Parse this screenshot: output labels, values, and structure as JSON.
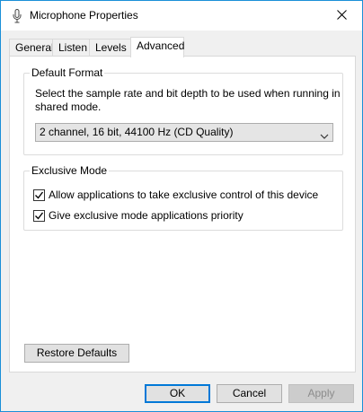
{
  "window": {
    "title": "Microphone Properties"
  },
  "icons": {
    "title": "microphone-icon",
    "close": "close-icon",
    "dropdown": "chevron-down-icon",
    "check": "checkmark-icon"
  },
  "tabs": [
    {
      "label": "General",
      "active": false
    },
    {
      "label": "Listen",
      "active": false
    },
    {
      "label": "Levels",
      "active": false
    },
    {
      "label": "Advanced",
      "active": true
    }
  ],
  "default_format": {
    "title": "Default Format",
    "description": "Select the sample rate and bit depth to be used when running in shared mode.",
    "selected": "2 channel, 16 bit, 44100 Hz (CD Quality)"
  },
  "exclusive_mode": {
    "title": "Exclusive Mode",
    "options": [
      {
        "label": "Allow applications to take exclusive control of this device",
        "checked": true
      },
      {
        "label": "Give exclusive mode applications priority",
        "checked": true
      }
    ]
  },
  "buttons": {
    "restore": "Restore Defaults",
    "ok": "OK",
    "cancel": "Cancel",
    "apply": "Apply"
  },
  "colors": {
    "window_border": "#1a8fd8",
    "accent": "#0078d7"
  }
}
